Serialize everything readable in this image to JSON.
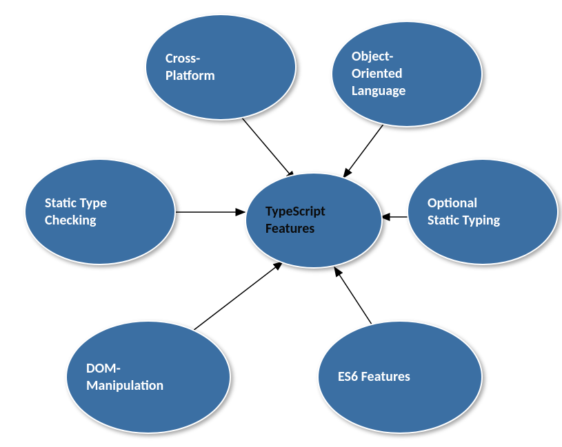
{
  "diagram": {
    "center": {
      "label": "TypeScript\nFeatures"
    },
    "nodes": {
      "cross_platform": {
        "label": "Cross-\nPlatform"
      },
      "object_oriented": {
        "label": "Object-\nOriented\nLanguage"
      },
      "static_type": {
        "label": "Static Type\nChecking"
      },
      "optional_static": {
        "label": "Optional\nStatic Typing"
      },
      "dom_manipulation": {
        "label": "DOM-\nManipulation"
      },
      "es6_features": {
        "label": "ES6 Features"
      }
    },
    "colors": {
      "node_fill": "#3b6fa3",
      "node_border": "#ffffff",
      "center_text": "#0b0b0b",
      "outer_text": "#ffffff",
      "arrow": "#000000"
    }
  }
}
